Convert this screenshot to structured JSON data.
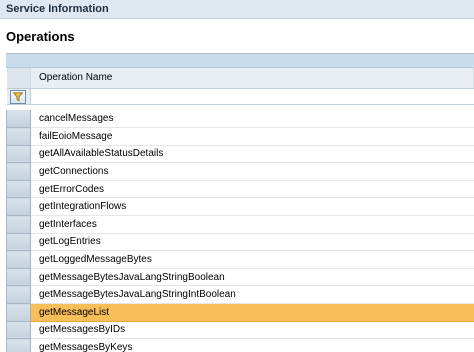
{
  "window": {
    "title": "Service Information"
  },
  "section": {
    "title": "Operations"
  },
  "table": {
    "column_header": "Operation Name",
    "filter_icon": "filter-funnel-icon",
    "selected_index": 11,
    "colors": {
      "selected_row": "#f8be58",
      "header_strip": "#c9dceb",
      "title_bar": "#dfe8f1"
    },
    "rows": [
      {
        "name": "cancelMessages"
      },
      {
        "name": "failEoioMessage"
      },
      {
        "name": "getAllAvailableStatusDetails"
      },
      {
        "name": "getConnections"
      },
      {
        "name": "getErrorCodes"
      },
      {
        "name": "getIntegrationFlows"
      },
      {
        "name": "getInterfaces"
      },
      {
        "name": "getLogEntries"
      },
      {
        "name": "getLoggedMessageBytes"
      },
      {
        "name": "getMessageBytesJavaLangStringBoolean"
      },
      {
        "name": "getMessageBytesJavaLangStringIntBoolean"
      },
      {
        "name": "getMessageList"
      },
      {
        "name": "getMessagesByIDs"
      },
      {
        "name": "getMessagesByKeys"
      }
    ]
  }
}
